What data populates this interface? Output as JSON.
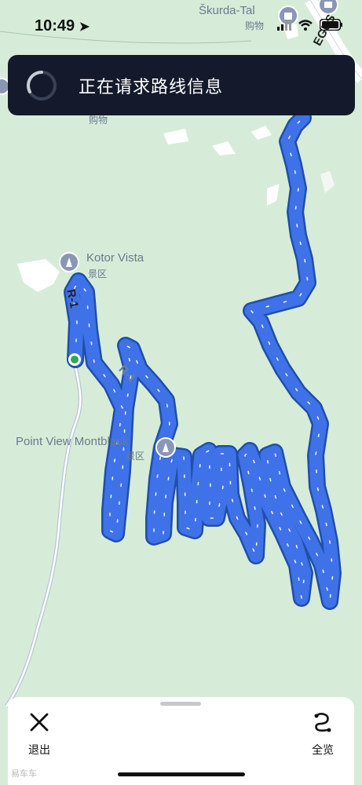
{
  "status_bar": {
    "time": "10:49"
  },
  "banner": {
    "message": "正在请求路线信息"
  },
  "map": {
    "labels": {
      "skurda_tal": "Škurda-Tal",
      "skurda_sub": "购物",
      "left_sub": "购物",
      "kotor_vista": "Kotor Vista",
      "kotor_vista_sub": "景区",
      "point_view": "Point View Montblack",
      "point_view_sub": "景区",
      "road_r1_a": "R-1",
      "road_r1_b": "R-1",
      "road_right": "EGUS"
    },
    "route_color": "#3f72e8",
    "water_color": "#ffffff",
    "land_color": "#d6ecd9"
  },
  "bottom_bar": {
    "exit_label": "退出",
    "overview_label": "全览"
  },
  "watermark": "易车车"
}
